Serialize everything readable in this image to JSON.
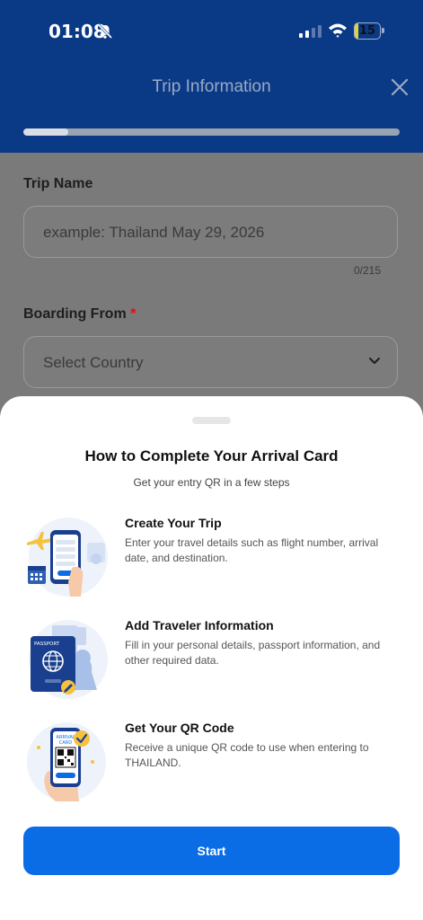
{
  "status_bar": {
    "time": "01:08",
    "battery": "15",
    "battery_level": 0.15
  },
  "header": {
    "title": "Trip Information",
    "progress": 0.12
  },
  "form": {
    "trip_name_label": "Trip Name",
    "trip_name_placeholder": "example: Thailand May 29, 2026",
    "trip_name_counter": "0/215",
    "boarding_label": "Boarding From",
    "required_mark": "*",
    "country_placeholder": "Select Country"
  },
  "sheet": {
    "title": "How to Complete Your Arrival Card",
    "subtitle": "Get your entry QR in a few steps",
    "steps": [
      {
        "title": "Create Your Trip",
        "desc": "Enter your travel details such as flight number, arrival date, and destination."
      },
      {
        "title": "Add Traveler Information",
        "desc": "Fill in your personal details, passport information, and other required data."
      },
      {
        "title": "Get Your QR Code",
        "desc": "Receive a unique QR code to use when entering to THAILAND."
      }
    ],
    "qr_card_label_1": "ARRIVAL",
    "qr_card_label_2": "CARD",
    "passport_label": "PASSPORT",
    "start_label": "Start"
  },
  "colors": {
    "header": "#0a3a86",
    "primary": "#0a6de6",
    "overlay": "#7a7a7a"
  }
}
